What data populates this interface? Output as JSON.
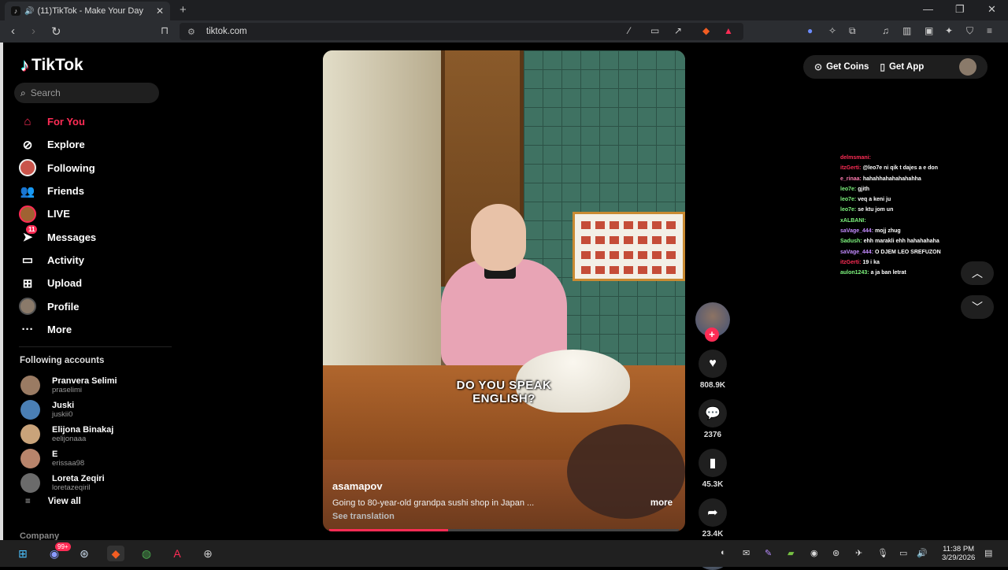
{
  "browser": {
    "tab_title": "(11)TikTok - Make Your Day",
    "url": "tiktok.com"
  },
  "sidebar": {
    "logo": "TikTok",
    "search_placeholder": "Search",
    "menu": [
      {
        "label": "For You",
        "icon": "home-icon",
        "active": true
      },
      {
        "label": "Explore",
        "icon": "compass-icon"
      },
      {
        "label": "Following",
        "icon": "following-avatar-icon"
      },
      {
        "label": "Friends",
        "icon": "friends-icon"
      },
      {
        "label": "LIVE",
        "icon": "live-icon"
      },
      {
        "label": "Messages",
        "icon": "send-icon",
        "badge": "11"
      },
      {
        "label": "Activity",
        "icon": "activity-icon"
      },
      {
        "label": "Upload",
        "icon": "upload-icon"
      },
      {
        "label": "Profile",
        "icon": "profile-avatar-icon"
      },
      {
        "label": "More",
        "icon": "more-icon"
      }
    ],
    "following_title": "Following accounts",
    "accounts": [
      {
        "name": "Pranvera Selimi",
        "handle": "praselimi",
        "color": "#9a7b63"
      },
      {
        "name": "Juski",
        "handle": "juskii0",
        "color": "#4a7fb5"
      },
      {
        "name": "Elijona Binakaj",
        "handle": "eelijonaaa",
        "color": "#c9a37a"
      },
      {
        "name": "E",
        "handle": "erissaa98",
        "color": "#b8846b"
      },
      {
        "name": "Loreta Zeqiri",
        "handle": "loretazeqiril",
        "color": "#6b6b6b"
      }
    ],
    "view_all": "View all",
    "company": "Company"
  },
  "video": {
    "caption_line1": "DO YOU SPEAK",
    "caption_line2": "ENGLISH?",
    "username": "asamapov",
    "description": "Going to 80-year-old grandpa sushi shop in Japan ...",
    "more": "more",
    "see_translation": "See translation",
    "progress": 0.34
  },
  "actions": {
    "likes": "808.9K",
    "comments": "2376",
    "saves": "45.3K",
    "shares": "23.4K"
  },
  "topbar": {
    "get_coins": "Get Coins",
    "get_app": "Get App"
  },
  "chat": [
    {
      "user": "delmsmani:",
      "msg": "",
      "color": "#fe2c55"
    },
    {
      "user": "itzGerti:",
      "msg": "@leo7e ni qik t dajes a e don",
      "color": "#fe2c55"
    },
    {
      "user": "e_rinaa:",
      "msg": "hahahhahahahahahha",
      "color": "#ff7bb0"
    },
    {
      "user": "leo7e:",
      "msg": "gjith",
      "color": "#7ef57e"
    },
    {
      "user": "leo7e:",
      "msg": "veq a keni ju",
      "color": "#7ef57e"
    },
    {
      "user": "leo7e:",
      "msg": "se ktu jom un",
      "color": "#7ef57e"
    },
    {
      "user": "xALBANI:",
      "msg": "",
      "color": "#7ef57e"
    },
    {
      "user": "saVage_444:",
      "msg": "mojj zhug",
      "color": "#c48bff"
    },
    {
      "user": "Sadush:",
      "msg": "ehh marakli ehh hahahahaha",
      "color": "#7ef57e"
    },
    {
      "user": "saVage_444:",
      "msg": "O DJEM LEO SREFUZON",
      "color": "#c48bff"
    },
    {
      "user": "itzGerti:",
      "msg": "19 i ka",
      "color": "#fe2c55"
    },
    {
      "user": "aulon1243:",
      "msg": "a ja ban letrat",
      "color": "#7ef57e"
    }
  ],
  "taskbar": {
    "time": "11:38 PM",
    "date": "3/29/2026",
    "discord_badge": "99+"
  }
}
